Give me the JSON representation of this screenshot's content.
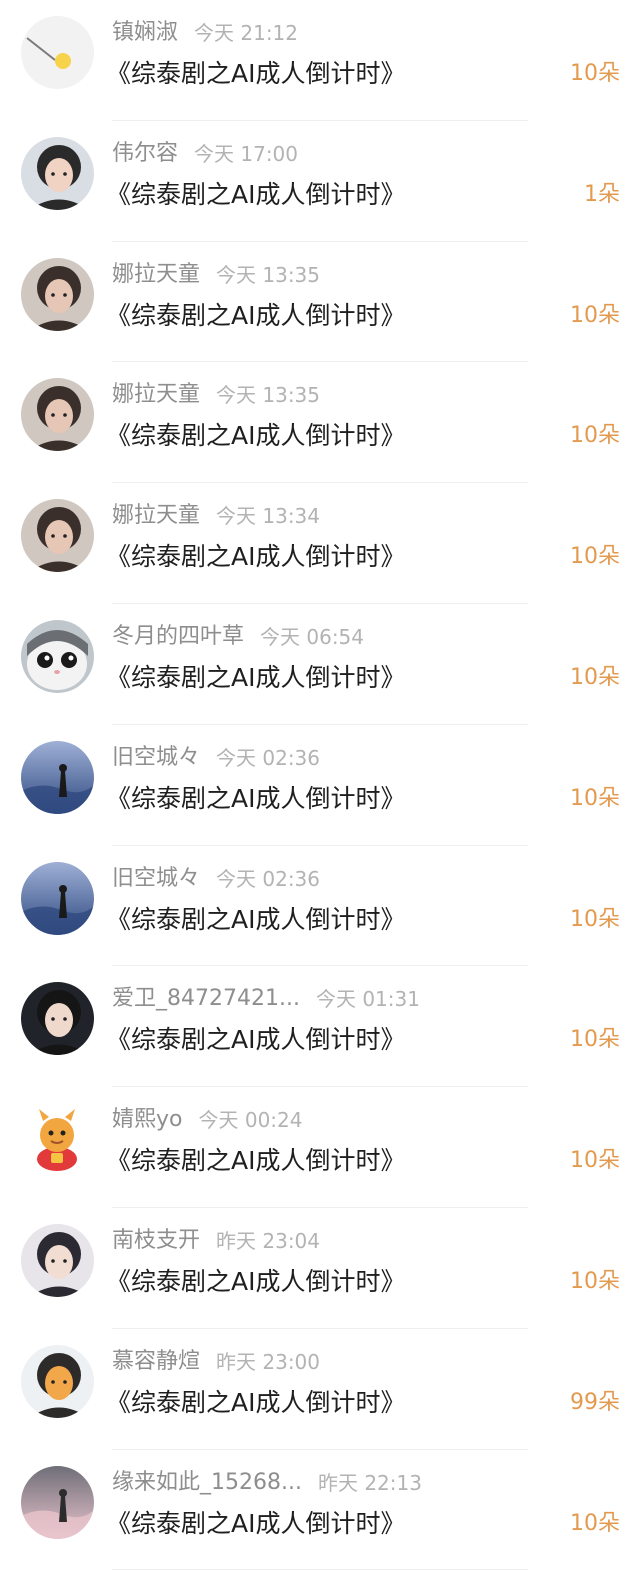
{
  "items": [
    {
      "name": "镇娴淑",
      "time": "今天 21:12",
      "title": "《综泰剧之AI成人倒计时》",
      "amount": "10朵",
      "avatar_icon": "lollipop-icon",
      "avatar_colors": [
        "#f2f2f2",
        "#f6d34a",
        "#7a7a7a"
      ]
    },
    {
      "name": "伟尔容",
      "time": "今天 17:00",
      "title": "《综泰剧之AI成人倒计时》",
      "amount": "1朵",
      "avatar_icon": "person-photo",
      "avatar_colors": [
        "#d9dde4",
        "#2a2a2a",
        "#f0d3c2"
      ]
    },
    {
      "name": "娜拉天童",
      "time": "今天 13:35",
      "title": "《综泰剧之AI成人倒计时》",
      "amount": "10朵",
      "avatar_icon": "person-photo",
      "avatar_colors": [
        "#cfc7c0",
        "#3a2f2a",
        "#e6c6b4"
      ]
    },
    {
      "name": "娜拉天童",
      "time": "今天 13:35",
      "title": "《综泰剧之AI成人倒计时》",
      "amount": "10朵",
      "avatar_icon": "person-photo",
      "avatar_colors": [
        "#cfc7c0",
        "#3a2f2a",
        "#e6c6b4"
      ]
    },
    {
      "name": "娜拉天童",
      "time": "今天 13:34",
      "title": "《综泰剧之AI成人倒计时》",
      "amount": "10朵",
      "avatar_icon": "person-photo",
      "avatar_colors": [
        "#cfc7c0",
        "#3a2f2a",
        "#e6c6b4"
      ]
    },
    {
      "name": "冬月的四叶草",
      "time": "今天 06:54",
      "title": "《综泰剧之AI成人倒计时》",
      "amount": "10朵",
      "avatar_icon": "cat-photo",
      "avatar_colors": [
        "#bfc6cc",
        "#6b6f74",
        "#f3f3f3"
      ]
    },
    {
      "name": "旧空城々",
      "time": "今天 02:36",
      "title": "《综泰剧之AI成人倒计时》",
      "amount": "10朵",
      "avatar_icon": "landscape-photo",
      "avatar_colors": [
        "#2f4a80",
        "#9fb0d6",
        "#1a1a1a"
      ]
    },
    {
      "name": "旧空城々",
      "time": "今天 02:36",
      "title": "《综泰剧之AI成人倒计时》",
      "amount": "10朵",
      "avatar_icon": "landscape-photo",
      "avatar_colors": [
        "#2f4a80",
        "#9fb0d6",
        "#1a1a1a"
      ]
    },
    {
      "name": "爱卫_84727421...",
      "time": "今天 01:31",
      "title": "《综泰剧之AI成人倒计时》",
      "amount": "10朵",
      "avatar_icon": "person-photo",
      "avatar_colors": [
        "#20242a",
        "#151515",
        "#efd9cc"
      ]
    },
    {
      "name": "婧熙yo",
      "time": "今天 00:24",
      "title": "《综泰剧之AI成人倒计时》",
      "amount": "10朵",
      "avatar_icon": "dragon-mascot-icon",
      "avatar_colors": [
        "#ffffff",
        "#f2a640",
        "#e23a3a"
      ]
    },
    {
      "name": "南枝支开",
      "time": "昨天 23:04",
      "title": "《综泰剧之AI成人倒计时》",
      "amount": "10朵",
      "avatar_icon": "person-photo",
      "avatar_colors": [
        "#e7e4ea",
        "#2b2a33",
        "#f2ddd2"
      ]
    },
    {
      "name": "慕容静煊",
      "time": "昨天 23:00",
      "title": "《综泰剧之AI成人倒计时》",
      "amount": "99朵",
      "avatar_icon": "person-photo",
      "avatar_colors": [
        "#eef1f4",
        "#2d2a2a",
        "#f2a84a"
      ]
    },
    {
      "name": "缘来如此_15268...",
      "time": "昨天 22:13",
      "title": "《综泰剧之AI成人倒计时》",
      "amount": "10朵",
      "avatar_icon": "landscape-photo",
      "avatar_colors": [
        "#e9c4cc",
        "#6f6e78",
        "#2c2c2c"
      ]
    }
  ],
  "colors": {
    "name": "#8e8e8e",
    "time": "#b3b3b3",
    "title": "#1f1f1f",
    "amount": "#e39a4f",
    "divider": "#efefef"
  }
}
